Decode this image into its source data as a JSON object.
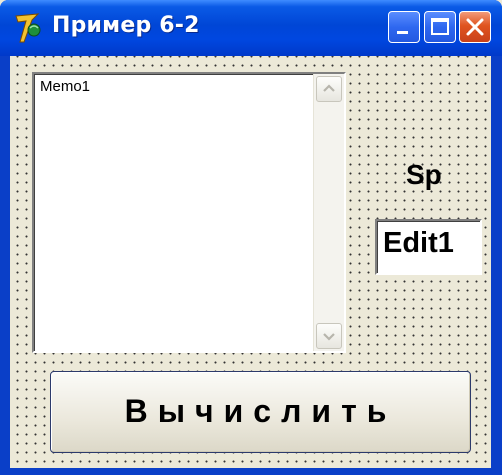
{
  "window": {
    "title": "Пример 6-2",
    "icon": "delphi-helmet-icon",
    "controls": [
      "minimize",
      "maximize",
      "close"
    ]
  },
  "form": {
    "memo": {
      "text": "Memo1"
    },
    "label": {
      "text": "Sp"
    },
    "edit": {
      "value": "Edit1"
    },
    "button": {
      "label": "Вычислить"
    }
  },
  "colors": {
    "titlebar": "#0046d6",
    "form_background": "#ece9d8",
    "close_button": "#e0541f"
  }
}
